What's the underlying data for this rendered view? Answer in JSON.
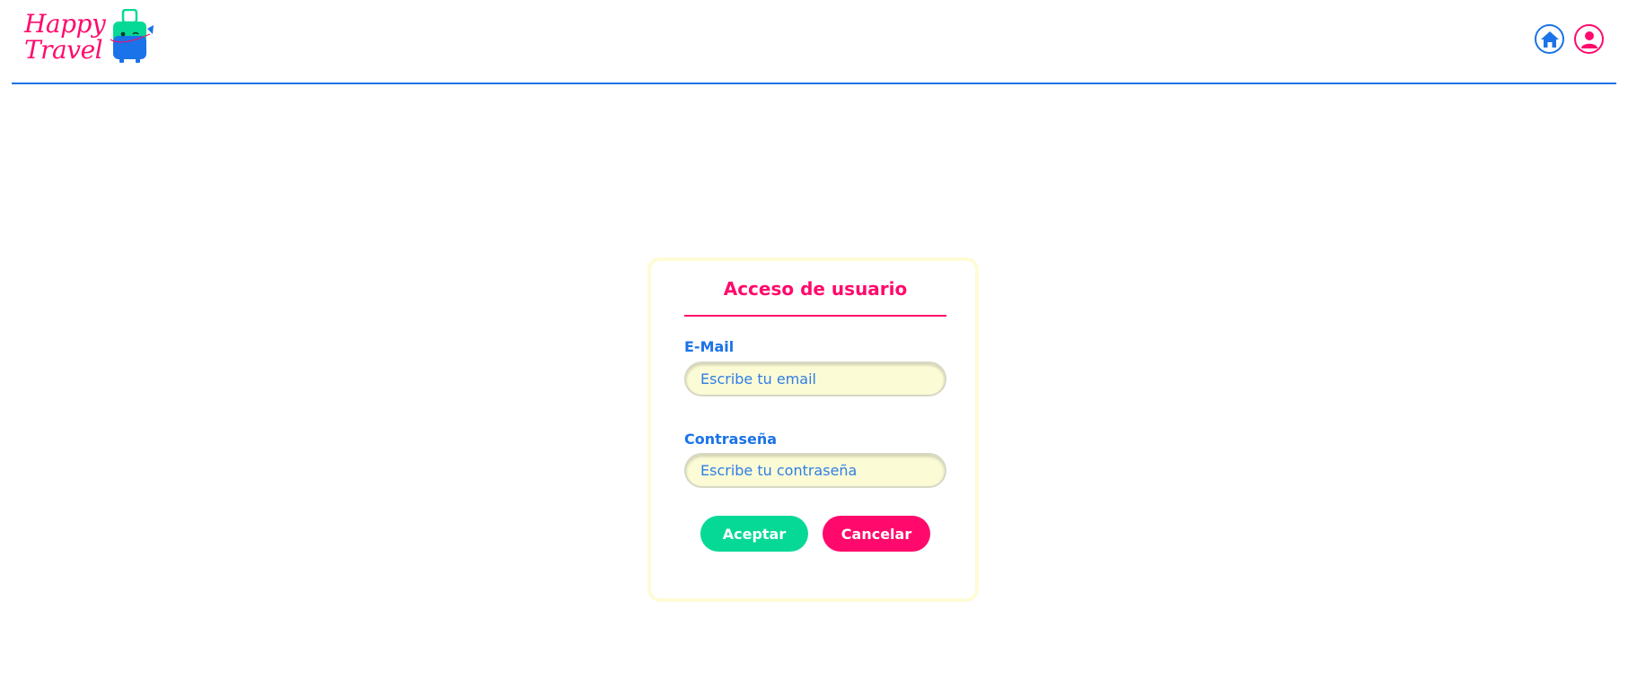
{
  "brand": {
    "name_line1": "Happy",
    "name_line2": "Travel",
    "primary_color": "#ff0a6c",
    "accent_blue": "#1a73e8",
    "accent_green": "#06d996",
    "logo_icon": "suitcase-mascot-icon"
  },
  "nav": {
    "home_icon": "home-icon",
    "user_icon": "user-icon"
  },
  "login": {
    "title": "Acceso de usuario",
    "email_label": "E-Mail",
    "email_placeholder": "Escribe tu email",
    "email_value": "",
    "password_label": "Contraseña",
    "password_placeholder": "Escribe tu contraseña",
    "password_value": "",
    "accept_label": "Aceptar",
    "cancel_label": "Cancelar"
  }
}
